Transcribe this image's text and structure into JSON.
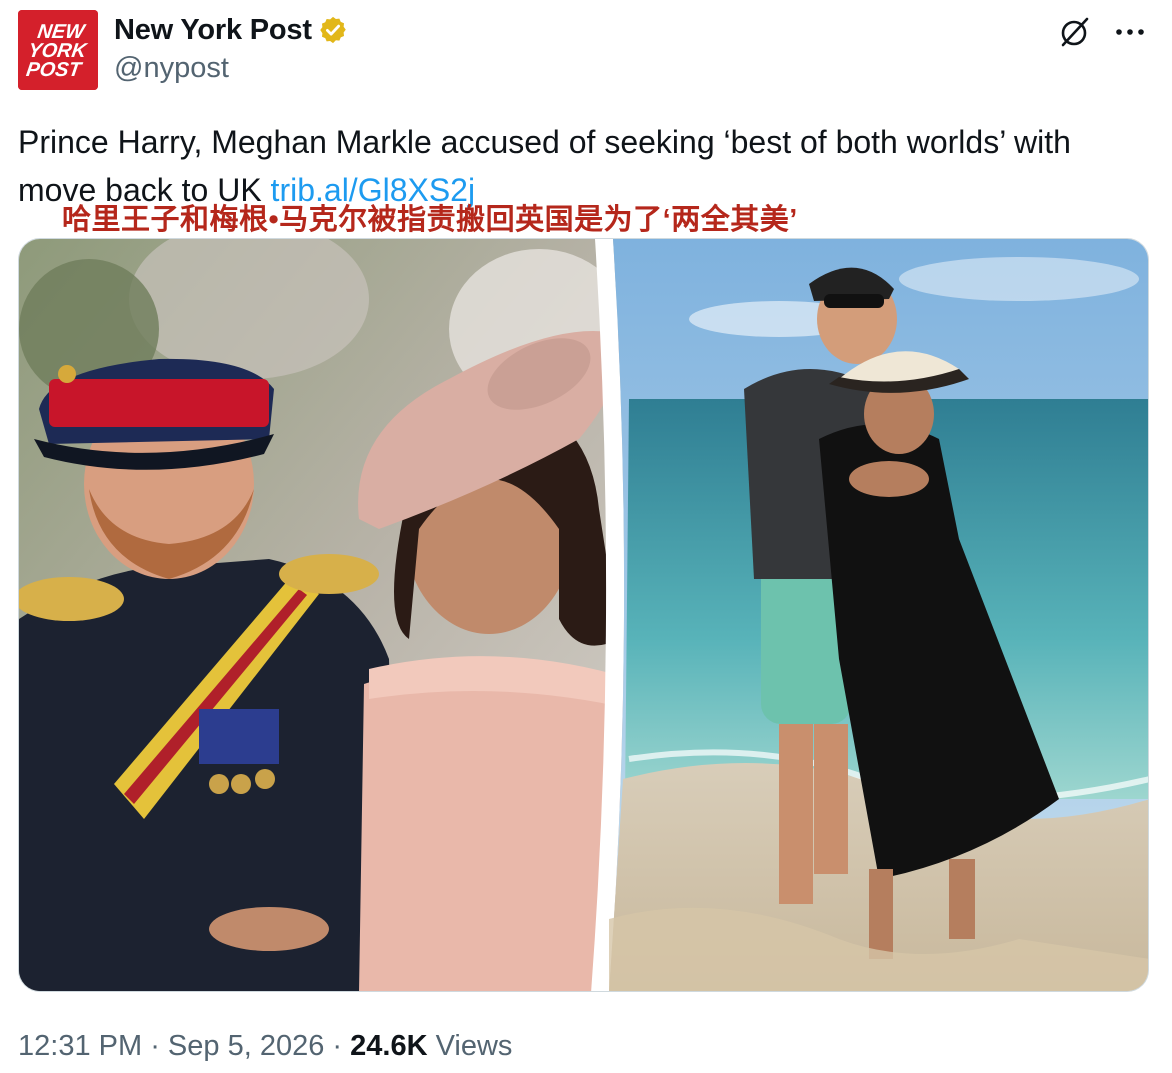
{
  "author": {
    "name": "New York Post",
    "handle": "@nypost",
    "avatar_text": [
      "NEW",
      "YORK",
      "POST"
    ],
    "verified_badge": "gold-check-badge-icon"
  },
  "header_actions": {
    "grok_icon": "grok-icon",
    "more_icon": "more-icon"
  },
  "tweet": {
    "text": "Prince Harry, Meghan Markle accused of seeking ‘best of both worlds’ with move back to UK ",
    "link": "trib.al/Gl8XS2j",
    "translation": "哈里王子和梅根•马克尔被指责搬回英国是为了‘两全其美’"
  },
  "meta": {
    "time": "12:31 PM",
    "separator": " · ",
    "date": "Sep 5, 2026",
    "views_count": "24.6K",
    "views_label": " Views"
  },
  "colors": {
    "brand_red": "#d4202b",
    "link_blue": "#1d9bf0",
    "muted_gray": "#536471",
    "translation_red": "#b5271b",
    "verified_gold": "#e2b719"
  }
}
